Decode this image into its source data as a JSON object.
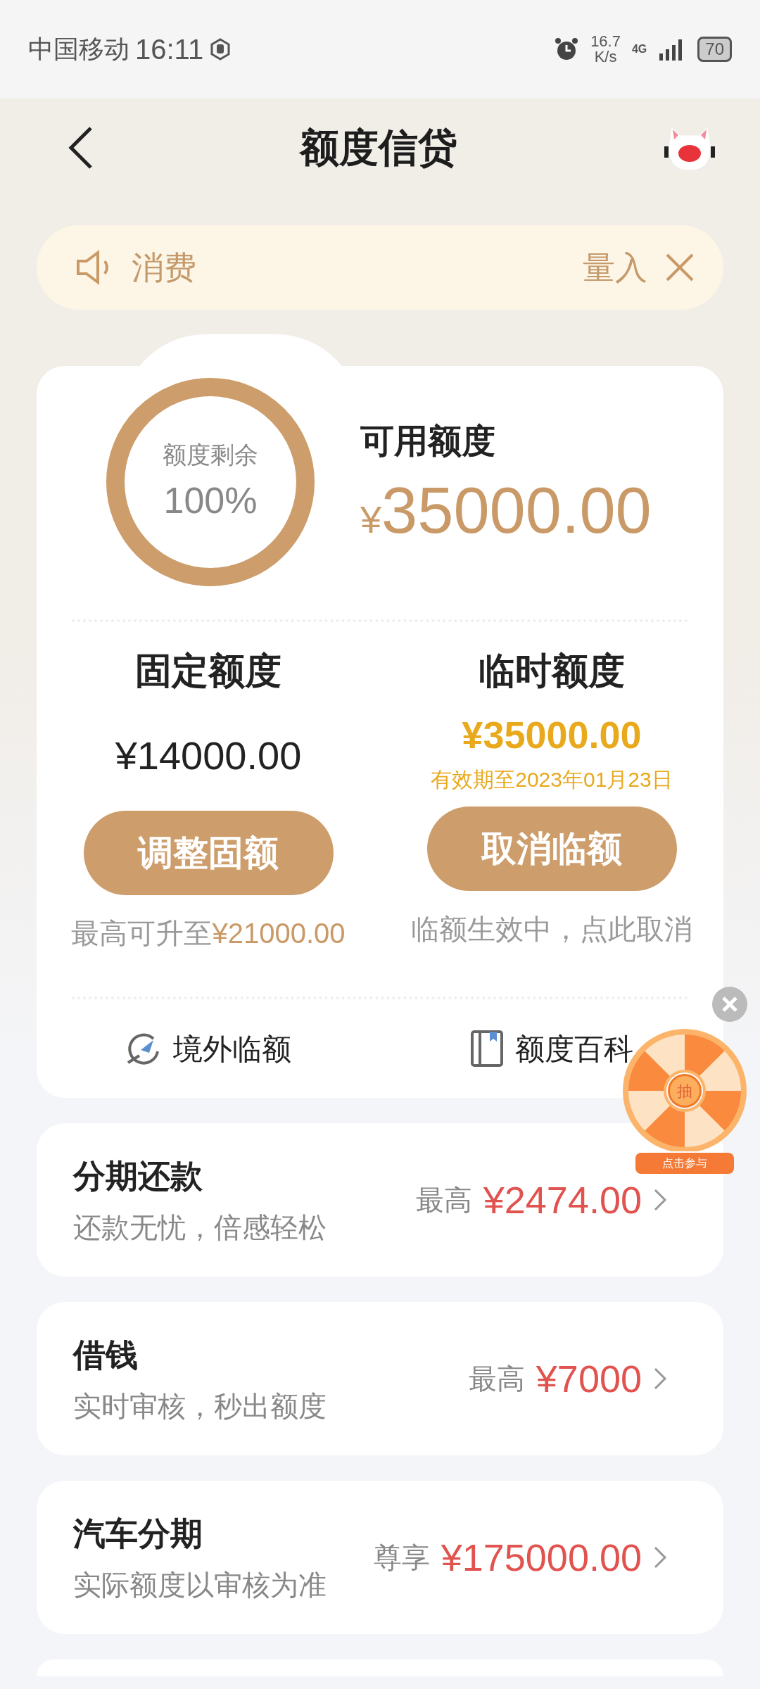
{
  "status_bar": {
    "carrier": "中国移动",
    "time": "16:11",
    "speed_value": "16.7",
    "speed_unit": "K/s",
    "network": "4G",
    "battery": "70"
  },
  "header": {
    "title": "额度信贷"
  },
  "notice": {
    "left_text": "消费",
    "right_text": "量入"
  },
  "summary": {
    "ring_label": "额度剩余",
    "ring_value": "100%",
    "level": 1.0,
    "available_label": "可用额度",
    "currency": "¥",
    "available_amount": "35000.00"
  },
  "quotas": [
    {
      "kind": "fixed",
      "title": "固定额度",
      "amount": "¥14000.00",
      "button": "调整固额",
      "note_prefix": "最高可升至",
      "note_amount": "¥21000.00"
    },
    {
      "kind": "temporary",
      "title": "临时额度",
      "amount": "¥35000.00",
      "validity": "有效期至2023年01月23日",
      "button": "取消临额",
      "note_prefix": "临额生效中，点此取消"
    }
  ],
  "links": [
    {
      "kind": "plane",
      "label": "境外临额"
    },
    {
      "kind": "book",
      "label": "额度百科"
    }
  ],
  "products": [
    {
      "title": "分期还款",
      "subtitle": "还款无忧，倍感轻松",
      "prefix": "最高",
      "amount": "¥2474.00"
    },
    {
      "title": "借钱",
      "subtitle": "实时审核，秒出额度",
      "prefix": "最高",
      "amount": "¥7000"
    },
    {
      "title": "汽车分期",
      "subtitle": "实际额度以审核为准",
      "prefix": "尊享",
      "amount": "¥175000.00"
    }
  ],
  "float_widget": {
    "center_label": "抽",
    "ribbon": "点击参与"
  }
}
